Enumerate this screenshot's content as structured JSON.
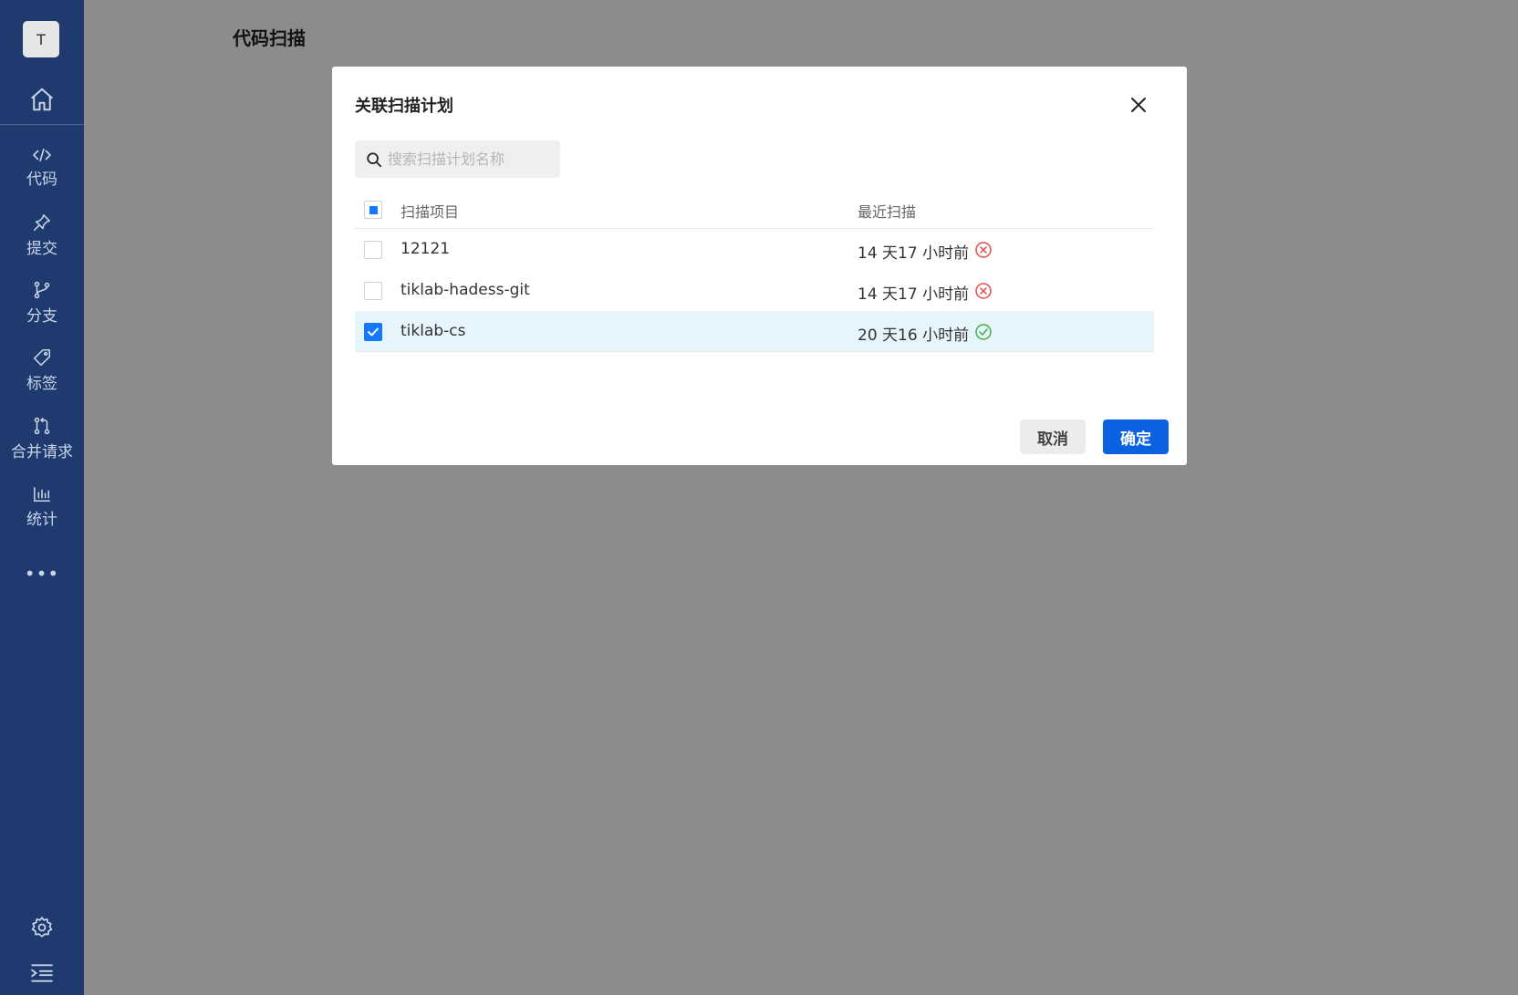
{
  "sidebar": {
    "avatar_initial": "T",
    "items": [
      {
        "label": "代码",
        "icon": "code-icon"
      },
      {
        "label": "提交",
        "icon": "pin-icon"
      },
      {
        "label": "分支",
        "icon": "branch-icon"
      },
      {
        "label": "标签",
        "icon": "tag-icon"
      },
      {
        "label": "合并请求",
        "icon": "merge-request-icon"
      },
      {
        "label": "统计",
        "icon": "stats-icon"
      }
    ],
    "more_label": "•••",
    "bg_color": "#1e3a6e"
  },
  "page": {
    "title": "代码扫描"
  },
  "modal": {
    "title": "关联扫描计划",
    "search_placeholder": "搜索扫描计划名称",
    "columns": {
      "name": "扫描项目",
      "recent": "最近扫描"
    },
    "header_checkbox_state": "indeterminate",
    "rows": [
      {
        "name": "12121",
        "recent": "14 天17 小时前",
        "status": "failed",
        "checked": false
      },
      {
        "name": "tiklab-hadess-git",
        "recent": "14 天17 小时前",
        "status": "failed",
        "checked": false
      },
      {
        "name": "tiklab-cs",
        "recent": "20 天16 小时前",
        "status": "success",
        "checked": true
      }
    ],
    "cancel_label": "取消",
    "ok_label": "确定",
    "colors": {
      "primary": "#0a62e0",
      "checkbox": "#1677ff",
      "failed": "#e84a4a",
      "success": "#3fb13f",
      "selected_row": "#e6f4fc"
    }
  }
}
